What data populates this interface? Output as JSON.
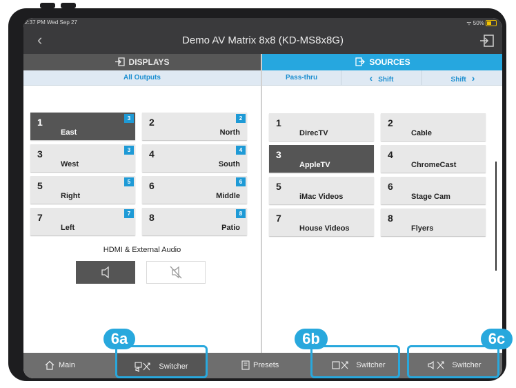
{
  "status": {
    "time": "2:37 PM  Wed Sep 27",
    "battery": "50%"
  },
  "header": {
    "title": "Demo AV Matrix 8x8 (KD-MS8x8G)",
    "back_glyph": "‹"
  },
  "displays": {
    "header": "DISPLAYS",
    "tab": "All Outputs",
    "tiles": [
      {
        "num": "1",
        "name": "East",
        "badge": "3",
        "selected": true
      },
      {
        "num": "2",
        "name": "North",
        "badge": "2",
        "selected": false
      },
      {
        "num": "3",
        "name": "West",
        "badge": "3",
        "selected": false
      },
      {
        "num": "4",
        "name": "South",
        "badge": "4",
        "selected": false
      },
      {
        "num": "5",
        "name": "Right",
        "badge": "5",
        "selected": false
      },
      {
        "num": "6",
        "name": "Middle",
        "badge": "6",
        "selected": false
      },
      {
        "num": "7",
        "name": "Left",
        "badge": "7",
        "selected": false
      },
      {
        "num": "8",
        "name": "Patio",
        "badge": "8",
        "selected": false
      }
    ],
    "audio_label": "HDMI & External Audio"
  },
  "sources": {
    "header": "SOURCES",
    "tabs": {
      "passthru": "Pass-thru",
      "shift_left": "Shift",
      "shift_right": "Shift"
    },
    "tiles": [
      {
        "num": "1",
        "name": "DirecTV",
        "selected": false
      },
      {
        "num": "2",
        "name": "Cable",
        "selected": false
      },
      {
        "num": "3",
        "name": "AppleTV",
        "selected": true
      },
      {
        "num": "4",
        "name": "ChromeCast",
        "selected": false
      },
      {
        "num": "5",
        "name": "iMac Videos",
        "selected": false
      },
      {
        "num": "6",
        "name": "Stage Cam",
        "selected": false
      },
      {
        "num": "7",
        "name": "House Videos",
        "selected": false
      },
      {
        "num": "8",
        "name": "Flyers",
        "selected": false
      }
    ]
  },
  "bottom_nav": {
    "main": "Main",
    "switcher_a": "Switcher",
    "presets": "Presets",
    "switcher_b": "Switcher",
    "switcher_c": "Switcher"
  },
  "callouts": {
    "a": "6a",
    "b": "6b",
    "c": "6c"
  },
  "colors": {
    "accent": "#26a7df",
    "selected_tile": "#555555",
    "callout": "#28a8dd"
  }
}
